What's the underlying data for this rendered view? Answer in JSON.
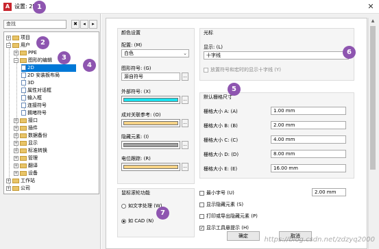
{
  "window": {
    "title": "设置: 2D",
    "app_icon": "A",
    "close_glyph": "✕"
  },
  "left": {
    "search_placeholder": "查找",
    "toolbar": [
      "✖",
      "◂",
      "▸"
    ],
    "tree": [
      {
        "label": "项目",
        "type": "folder",
        "exp": "+"
      },
      {
        "label": "用户",
        "type": "folder",
        "exp": "−"
      },
      {
        "label": "PPE",
        "type": "folder",
        "exp": "+"
      },
      {
        "label": "图形的编辑",
        "type": "folder",
        "exp": "−"
      },
      {
        "label": "2D",
        "type": "doc",
        "exp": ""
      },
      {
        "label": "2D 安装板布局",
        "type": "doc",
        "exp": ""
      },
      {
        "label": "3D",
        "type": "doc",
        "exp": ""
      },
      {
        "label": "属性对话框",
        "type": "doc",
        "exp": ""
      },
      {
        "label": "输入框",
        "type": "doc",
        "exp": ""
      },
      {
        "label": "连接符号",
        "type": "doc",
        "exp": ""
      },
      {
        "label": "拥堵符号",
        "type": "doc",
        "exp": ""
      },
      {
        "label": "接口",
        "type": "folder",
        "exp": "+"
      },
      {
        "label": "插件",
        "type": "folder",
        "exp": "+"
      },
      {
        "label": "数据备份",
        "type": "folder",
        "exp": "+"
      },
      {
        "label": "显示",
        "type": "folder",
        "exp": "+"
      },
      {
        "label": "标准转换",
        "type": "folder",
        "exp": "+"
      },
      {
        "label": "管理",
        "type": "folder",
        "exp": "+"
      },
      {
        "label": "翻译",
        "type": "folder",
        "exp": "+"
      },
      {
        "label": "设备",
        "type": "folder",
        "exp": "+"
      },
      {
        "label": "工作站",
        "type": "folder",
        "exp": "+"
      },
      {
        "label": "公司",
        "type": "folder",
        "exp": "+"
      }
    ]
  },
  "color": {
    "group_label": "颜色设置",
    "scheme_label": "配置: (M)",
    "scheme_value": "白色",
    "symbol_label": "图形符号: (G)",
    "symbol_value": "源自符号",
    "external_label": "外部符号: (X)",
    "external_color": "#19e1ee",
    "matched_label": "成对关联参考: (O)",
    "matched_color": "#f6d387",
    "hidden_label": "隐藏元素: (I)",
    "hidden_color": "#a0a0a0",
    "potential_label": "电位跟踪: (R)",
    "potential_color": "#f6d387",
    "dots": "..."
  },
  "cursor": {
    "group_label": "光标",
    "display_label": "显示: (L)",
    "display_value": "十字线",
    "check_label": "放置符号和宏时的显示十字线 (Y)"
  },
  "grid": {
    "group_label": "默认栅格尺寸",
    "rows": [
      {
        "label": "栅格大小 A: (A)",
        "value": "1.00 mm"
      },
      {
        "label": "栅格大小 B: (B)",
        "value": "2.00 mm"
      },
      {
        "label": "栅格大小 C: (C)",
        "value": "4.00 mm"
      },
      {
        "label": "栅格大小 D: (D)",
        "value": "8.00 mm"
      },
      {
        "label": "栅格大小 E: (E)",
        "value": "16.00 mm"
      }
    ]
  },
  "mouse": {
    "group_label": "鼠标滚轮功能",
    "opt1": "如文字处理 (W)",
    "opt2": "如 CAD (N)"
  },
  "options": {
    "min_font_label": "最小字号 (U)",
    "min_font_value": "2.00 mm",
    "show_hidden": "显示隐藏元素 (S)",
    "print_hidden": "打印或导出隐藏元素 (P)",
    "show_tooltip": "显示工具悬提示 (H)"
  },
  "buttons": {
    "ok": "确定",
    "cancel": "取消"
  },
  "badges": [
    "1",
    "2",
    "3",
    "4",
    "5",
    "6",
    "7"
  ],
  "watermark": "https://blog.csdn.net/zdzyq2000"
}
